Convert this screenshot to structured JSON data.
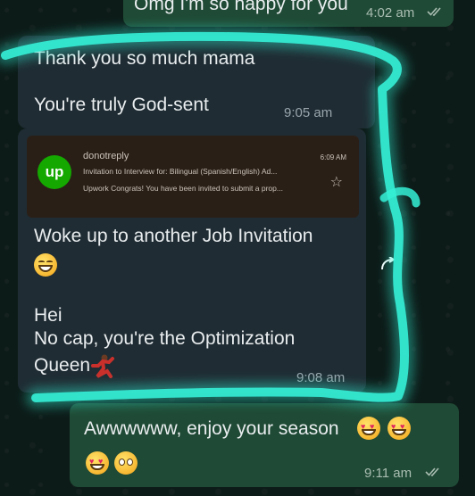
{
  "messages": {
    "top_out": {
      "text": "Omg I'm so happy for you",
      "time": "4:02 am"
    },
    "thank_you": {
      "line1": "Thank you so much mama",
      "line2": "You're truly God-sent",
      "time": "9:05 am"
    },
    "email_preview": {
      "logo": "up",
      "sender": "donotreply",
      "time": "6:09 AM",
      "subject": "Invitation to Interview for: Bilingual (Spanish/English) Ad...",
      "snippet": "Upwork Congrats! You have been invited to submit a prop..."
    },
    "job_invite": {
      "line1": "Woke up to another Job Invitation",
      "line2": "Hei",
      "line3": "No cap, you're the Optimization",
      "line4": "Queen",
      "time": "9:08 am"
    },
    "reply_out": {
      "text": "Awwwwww, enjoy your season",
      "time": "9:11 am"
    }
  },
  "icons": {
    "read_receipt": "double-check-icon",
    "star": "star-icon",
    "reply_arrow": "reply-arrow-icon"
  },
  "colors": {
    "outgoing_bubble": "#1f4a35",
    "incoming_bubble": "#1f2c33",
    "highlight_glow": "#2de0c8",
    "read_tick": "#a9bdb2"
  }
}
